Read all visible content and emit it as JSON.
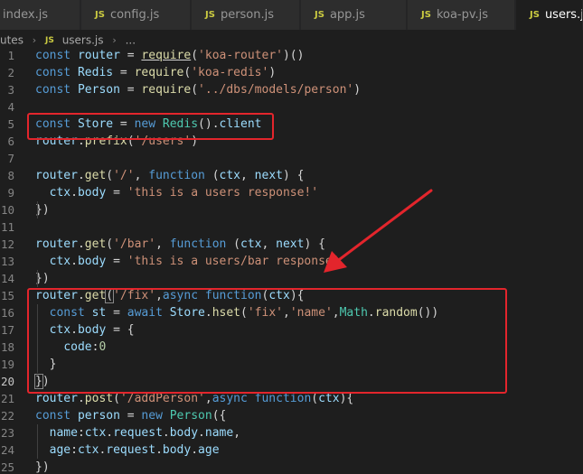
{
  "tabs": [
    {
      "label": "index.js",
      "has_js_icon": false,
      "active": false
    },
    {
      "label": "config.js",
      "has_js_icon": true,
      "active": false
    },
    {
      "label": "person.js",
      "has_js_icon": true,
      "active": false
    },
    {
      "label": "app.js",
      "has_js_icon": true,
      "active": false
    },
    {
      "label": "koa-pv.js",
      "has_js_icon": true,
      "active": false
    },
    {
      "label": "users.js",
      "has_js_icon": true,
      "active": true
    }
  ],
  "js_icon_text": "JS",
  "breadcrumb": {
    "folder": "utes",
    "file": "users.js",
    "more": "...",
    "separator": "›"
  },
  "lines": [
    {
      "n": "1",
      "tokens": [
        [
          "kw",
          "const"
        ],
        [
          "plain",
          " "
        ],
        [
          "var",
          "router"
        ],
        [
          "plain",
          " = "
        ],
        [
          "fn",
          "require",
          "under"
        ],
        [
          "plain",
          "("
        ],
        [
          "str",
          "'koa-router'"
        ],
        [
          "plain",
          ")()"
        ]
      ]
    },
    {
      "n": "2",
      "tokens": [
        [
          "kw",
          "const"
        ],
        [
          "plain",
          " "
        ],
        [
          "var",
          "Redis"
        ],
        [
          "plain",
          " = "
        ],
        [
          "fn",
          "require"
        ],
        [
          "plain",
          "("
        ],
        [
          "str",
          "'koa-redis'"
        ],
        [
          "plain",
          ")"
        ]
      ]
    },
    {
      "n": "3",
      "tokens": [
        [
          "kw",
          "const"
        ],
        [
          "plain",
          " "
        ],
        [
          "var",
          "Person"
        ],
        [
          "plain",
          " = "
        ],
        [
          "fn",
          "require"
        ],
        [
          "plain",
          "("
        ],
        [
          "str",
          "'../dbs/models/person'"
        ],
        [
          "plain",
          ")"
        ]
      ]
    },
    {
      "n": "4",
      "tokens": []
    },
    {
      "n": "5",
      "tokens": [
        [
          "kw",
          "const"
        ],
        [
          "plain",
          " "
        ],
        [
          "var",
          "Store"
        ],
        [
          "plain",
          " = "
        ],
        [
          "kw",
          "new"
        ],
        [
          "plain",
          " "
        ],
        [
          "cls",
          "Redis"
        ],
        [
          "plain",
          "()."
        ],
        [
          "var",
          "client"
        ]
      ]
    },
    {
      "n": "6",
      "tokens": [
        [
          "var",
          "router"
        ],
        [
          "plain",
          "."
        ],
        [
          "fn",
          "prefix"
        ],
        [
          "plain",
          "("
        ],
        [
          "str",
          "'/users'"
        ],
        [
          "plain",
          ")"
        ]
      ]
    },
    {
      "n": "7",
      "tokens": []
    },
    {
      "n": "8",
      "tokens": [
        [
          "var",
          "router"
        ],
        [
          "plain",
          "."
        ],
        [
          "fn",
          "get"
        ],
        [
          "plain",
          "("
        ],
        [
          "str",
          "'/'"
        ],
        [
          "plain",
          ", "
        ],
        [
          "kw",
          "function"
        ],
        [
          "plain",
          " ("
        ],
        [
          "var",
          "ctx"
        ],
        [
          "plain",
          ", "
        ],
        [
          "var",
          "next"
        ],
        [
          "plain",
          ") {"
        ]
      ]
    },
    {
      "n": "9",
      "tokens": [
        [
          "plain",
          "  "
        ],
        [
          "var",
          "ctx"
        ],
        [
          "plain",
          "."
        ],
        [
          "var",
          "body"
        ],
        [
          "plain",
          " = "
        ],
        [
          "str",
          "'this is a users response!'"
        ]
      ]
    },
    {
      "n": "10",
      "tokens": [
        [
          "plain",
          "})"
        ]
      ]
    },
    {
      "n": "11",
      "tokens": []
    },
    {
      "n": "12",
      "tokens": [
        [
          "var",
          "router"
        ],
        [
          "plain",
          "."
        ],
        [
          "fn",
          "get"
        ],
        [
          "plain",
          "("
        ],
        [
          "str",
          "'/bar'"
        ],
        [
          "plain",
          ", "
        ],
        [
          "kw",
          "function"
        ],
        [
          "plain",
          " ("
        ],
        [
          "var",
          "ctx"
        ],
        [
          "plain",
          ", "
        ],
        [
          "var",
          "next"
        ],
        [
          "plain",
          ") {"
        ]
      ]
    },
    {
      "n": "13",
      "tokens": [
        [
          "plain",
          "  "
        ],
        [
          "var",
          "ctx"
        ],
        [
          "plain",
          "."
        ],
        [
          "var",
          "body"
        ],
        [
          "plain",
          " = "
        ],
        [
          "str",
          "'this is a users/bar response'"
        ]
      ]
    },
    {
      "n": "14",
      "tokens": [
        [
          "plain",
          "})"
        ]
      ]
    },
    {
      "n": "15",
      "tokens": [
        [
          "var",
          "router"
        ],
        [
          "plain",
          "."
        ],
        [
          "fn",
          "get"
        ],
        [
          "plain",
          "(",
          "brk"
        ],
        [
          "str",
          "'/fix'"
        ],
        [
          "plain",
          ","
        ],
        [
          "kw",
          "async"
        ],
        [
          "plain",
          " "
        ],
        [
          "kw",
          "function"
        ],
        [
          "plain",
          "("
        ],
        [
          "var",
          "ctx"
        ],
        [
          "plain",
          "){"
        ]
      ]
    },
    {
      "n": "16",
      "tokens": [
        [
          "plain",
          "  "
        ],
        [
          "kw",
          "const"
        ],
        [
          "plain",
          " "
        ],
        [
          "var",
          "st"
        ],
        [
          "plain",
          " = "
        ],
        [
          "kw",
          "await"
        ],
        [
          "plain",
          " "
        ],
        [
          "var",
          "Store"
        ],
        [
          "plain",
          "."
        ],
        [
          "fn",
          "hset"
        ],
        [
          "plain",
          "("
        ],
        [
          "str",
          "'fix'"
        ],
        [
          "plain",
          ","
        ],
        [
          "str",
          "'name'"
        ],
        [
          "plain",
          ","
        ],
        [
          "cls",
          "Math"
        ],
        [
          "plain",
          "."
        ],
        [
          "fn",
          "random"
        ],
        [
          "plain",
          "())"
        ]
      ]
    },
    {
      "n": "17",
      "tokens": [
        [
          "plain",
          "  "
        ],
        [
          "var",
          "ctx"
        ],
        [
          "plain",
          "."
        ],
        [
          "var",
          "body"
        ],
        [
          "plain",
          " = {"
        ]
      ]
    },
    {
      "n": "18",
      "tokens": [
        [
          "plain",
          "    "
        ],
        [
          "var",
          "code"
        ],
        [
          "plain",
          ":"
        ],
        [
          "num",
          "0"
        ]
      ]
    },
    {
      "n": "19",
      "tokens": [
        [
          "plain",
          "  }"
        ]
      ]
    },
    {
      "n": "20",
      "tokens": [
        [
          "plain",
          "}",
          "brk"
        ],
        [
          "plain",
          ")"
        ]
      ],
      "current": true
    },
    {
      "n": "21",
      "tokens": [
        [
          "var",
          "router"
        ],
        [
          "plain",
          "."
        ],
        [
          "fn",
          "post"
        ],
        [
          "plain",
          "("
        ],
        [
          "str",
          "'/addPerson'"
        ],
        [
          "plain",
          ","
        ],
        [
          "kw",
          "async"
        ],
        [
          "plain",
          " "
        ],
        [
          "kw",
          "function"
        ],
        [
          "plain",
          "("
        ],
        [
          "var",
          "ctx"
        ],
        [
          "plain",
          "){"
        ]
      ]
    },
    {
      "n": "22",
      "tokens": [
        [
          "kw",
          "const"
        ],
        [
          "plain",
          " "
        ],
        [
          "var",
          "person"
        ],
        [
          "plain",
          " = "
        ],
        [
          "kw",
          "new"
        ],
        [
          "plain",
          " "
        ],
        [
          "cls",
          "Person"
        ],
        [
          "plain",
          "({"
        ]
      ]
    },
    {
      "n": "23",
      "tokens": [
        [
          "plain",
          "  "
        ],
        [
          "var",
          "name"
        ],
        [
          "plain",
          ":"
        ],
        [
          "var",
          "ctx"
        ],
        [
          "plain",
          "."
        ],
        [
          "var",
          "request"
        ],
        [
          "plain",
          "."
        ],
        [
          "var",
          "body"
        ],
        [
          "plain",
          "."
        ],
        [
          "var",
          "name"
        ],
        [
          "plain",
          ","
        ]
      ]
    },
    {
      "n": "24",
      "tokens": [
        [
          "plain",
          "  "
        ],
        [
          "var",
          "age"
        ],
        [
          "plain",
          ":"
        ],
        [
          "var",
          "ctx"
        ],
        [
          "plain",
          "."
        ],
        [
          "var",
          "request"
        ],
        [
          "plain",
          "."
        ],
        [
          "var",
          "body"
        ],
        [
          "plain",
          "."
        ],
        [
          "var",
          "age"
        ]
      ]
    },
    {
      "n": "25",
      "tokens": [
        [
          "plain",
          "})"
        ]
      ]
    }
  ],
  "annotation_color": "#e3252c",
  "syntax_colors": {
    "keyword": "#569cd6",
    "variable": "#9cdcfe",
    "function": "#dcdcaa",
    "string": "#ce9178",
    "number": "#b5cea8",
    "class": "#4ec9b0",
    "text": "#d4d4d4",
    "background": "#1e1e1e"
  }
}
